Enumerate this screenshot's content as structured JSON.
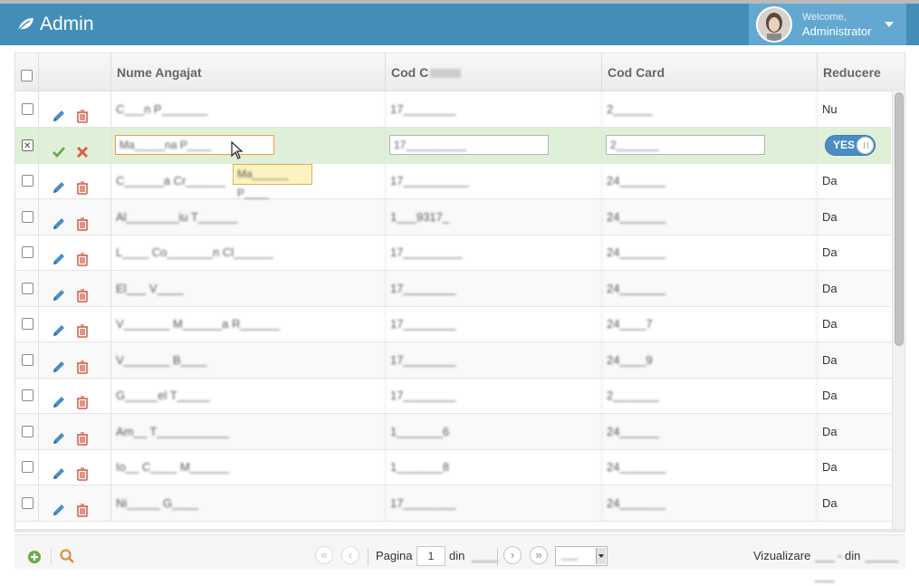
{
  "app": {
    "title": "Admin",
    "logo_icon": "leaf-icon"
  },
  "user": {
    "welcome": "Welcome,",
    "name": "Administrator"
  },
  "colors": {
    "navbar": "#438eb9",
    "user_box": "#62a8d1",
    "edit_row": "#dff0d8",
    "edit_icon": "#478fca",
    "delete_icon": "#d15b47",
    "save_icon": "#69aa46"
  },
  "grid": {
    "columns": [
      "Nume Angajat",
      "Cod C",
      "Cod Card",
      "Reducere"
    ],
    "rows": [
      {
        "name": "C___n P_______",
        "cod": "17________",
        "card": "2______",
        "reducere": "Nu"
      },
      {
        "name": "Ma_____na P____",
        "cod": "17__________",
        "card": "2_______",
        "reducere": "YES",
        "editing": true,
        "focused_field": "name"
      },
      {
        "name": "C______a Cr______",
        "cod": "17__________",
        "card": "24_______",
        "reducere": "Da"
      },
      {
        "name": "Al________iu T______",
        "cod": "1___9317_",
        "card": "24_______",
        "reducere": "Da"
      },
      {
        "name": "L____ Co_______n Cl______",
        "cod": "17_________",
        "card": "24_______",
        "reducere": "Da"
      },
      {
        "name": "El___ V____",
        "cod": "17________",
        "card": "24_______",
        "reducere": "Da"
      },
      {
        "name": "V_______ M______a R______",
        "cod": "17________",
        "card": "24____7",
        "reducere": "Da"
      },
      {
        "name": "V_______ B____",
        "cod": "17________",
        "card": "24____9",
        "reducere": "Da"
      },
      {
        "name": "G_____el T_____",
        "cod": "17________",
        "card": "2_______",
        "reducere": "Da"
      },
      {
        "name": "Am__ T___________",
        "cod": "1_______6",
        "card": "24______",
        "reducere": "Da"
      },
      {
        "name": "Io__ C____ M______",
        "cod": "1_______8",
        "card": "24_______",
        "reducere": "Da"
      },
      {
        "name": "Ni_____ G____",
        "cod": "17________",
        "card": "24_______",
        "reducere": "Da"
      }
    ]
  },
  "tooltip": "Ma______ P____",
  "pager": {
    "page_label": "Pagina",
    "page": "1",
    "of_label": "din",
    "total_pages": "____",
    "rows_per_page": "___",
    "view_label": "Vizualizare",
    "view_range": "___ - ___",
    "view_of": "din",
    "view_total": "_____"
  },
  "icons": {
    "add": "plus-circle-icon",
    "search": "search-icon",
    "first": "double-chevron-left-icon",
    "prev": "chevron-left-icon",
    "next": "chevron-right-icon",
    "last": "double-chevron-right-icon"
  }
}
